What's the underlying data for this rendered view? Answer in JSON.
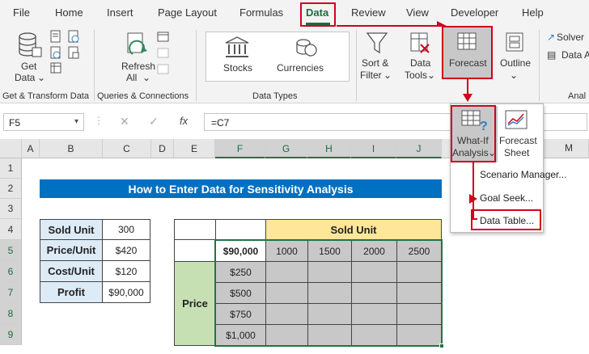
{
  "tabs": [
    "File",
    "Home",
    "Insert",
    "Page Layout",
    "Formulas",
    "Data",
    "Review",
    "View",
    "Developer",
    "Help"
  ],
  "ribbon": {
    "get_data": "Get",
    "get_data2": "Data",
    "refresh": "Refresh",
    "refresh2": "All",
    "stocks": "Stocks",
    "currencies": "Currencies",
    "sort": "Sort &",
    "filter": "Filter",
    "data_tools": "Data",
    "data_tools2": "Tools",
    "forecast": "Forecast",
    "outline": "Outline",
    "solver": "Solver",
    "data_a": "Data A",
    "group_get": "Get & Transform Data",
    "group_queries": "Queries & Connections",
    "group_types": "Data Types",
    "group_anal": "Anal"
  },
  "formula_bar": {
    "name_box": "F5",
    "fx": "fx",
    "value": "=C7"
  },
  "columns": [
    "A",
    "B",
    "C",
    "D",
    "E",
    "F",
    "G",
    "H",
    "I",
    "J",
    "M"
  ],
  "rows": [
    "1",
    "2",
    "3",
    "4",
    "5",
    "6",
    "7",
    "8",
    "9"
  ],
  "sheet": {
    "title": "How to Enter Data for Sensitivity Analysis",
    "inputs": [
      {
        "label": "Sold Unit",
        "value": "300"
      },
      {
        "label": "Price/Unit",
        "value": "$420"
      },
      {
        "label": "Cost/Unit",
        "value": "$120"
      },
      {
        "label": "Profit",
        "value": "$90,000"
      }
    ],
    "table_header": "Sold Unit",
    "corner": "$90,000",
    "units": [
      "1000",
      "1500",
      "2000",
      "2500"
    ],
    "price_label": "Price",
    "prices": [
      "$250",
      "$500",
      "$750",
      "$1,000"
    ]
  },
  "whatif": {
    "whatif1": "What-If",
    "whatif2": "Analysis",
    "forecast_sheet1": "Forecast",
    "forecast_sheet2": "Sheet",
    "items": [
      "Scenario Manager...",
      "Goal Seek...",
      "Data Table..."
    ]
  },
  "colors": {
    "accent": "#217346",
    "title_bg": "#0070c0",
    "input_bg": "#ddebf7",
    "header_bg": "#ffe699",
    "price_bg": "#c6e0b4",
    "selected": "#bfbfbf",
    "highlight": "#d0021b"
  }
}
